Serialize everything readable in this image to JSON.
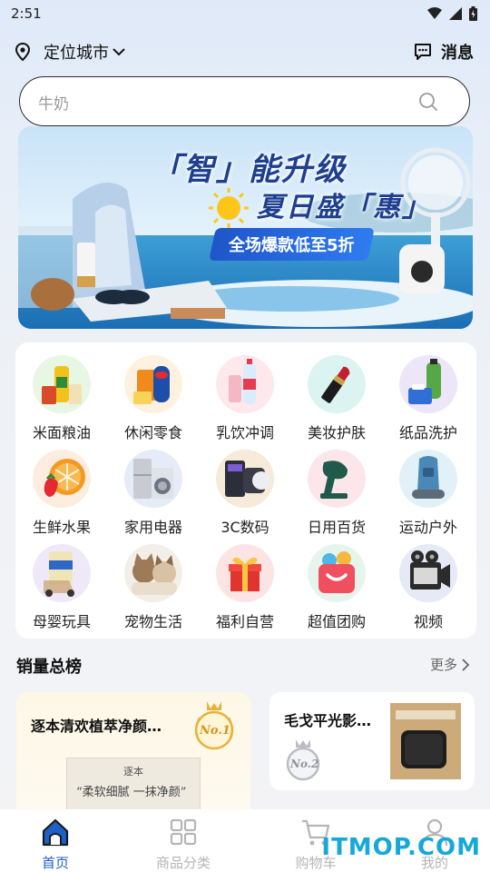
{
  "status": {
    "time": "2:51"
  },
  "header": {
    "location_label": "定位城市",
    "message_label": "消息"
  },
  "search": {
    "placeholder": "牛奶"
  },
  "banner": {
    "line1": "「智」能升级",
    "line2": "夏日盛「惠」",
    "promo": "全场爆款低至5折"
  },
  "categories": [
    {
      "label": "米面粮油",
      "icon": "grain-oil-icon"
    },
    {
      "label": "休闲零食",
      "icon": "snacks-icon"
    },
    {
      "label": "乳饮冲调",
      "icon": "drinks-icon"
    },
    {
      "label": "美妆护肤",
      "icon": "cosmetics-icon"
    },
    {
      "label": "纸品洗护",
      "icon": "paper-care-icon"
    },
    {
      "label": "生鲜水果",
      "icon": "fruit-icon"
    },
    {
      "label": "家用电器",
      "icon": "appliance-icon"
    },
    {
      "label": "3C数码",
      "icon": "digital-icon"
    },
    {
      "label": "日用百货",
      "icon": "daily-goods-icon"
    },
    {
      "label": "运动户外",
      "icon": "outdoor-icon"
    },
    {
      "label": "母婴玩具",
      "icon": "baby-icon"
    },
    {
      "label": "宠物生活",
      "icon": "pet-icon"
    },
    {
      "label": "福利自营",
      "icon": "gift-icon"
    },
    {
      "label": "超值团购",
      "icon": "group-buy-icon"
    },
    {
      "label": "视频",
      "icon": "video-icon"
    }
  ],
  "ranking": {
    "title": "销量总榜",
    "more_label": "更多",
    "items": [
      {
        "title": "逐本清欢植萃净颜…",
        "rank": "No.1",
        "product_brand": "逐本",
        "product_slogan": "“柔软细腻 一抹净颜”"
      },
      {
        "title": "毛戈平光影…",
        "rank": "No.2"
      }
    ]
  },
  "tabs": [
    {
      "label": "首页",
      "active": true,
      "icon": "home-icon"
    },
    {
      "label": "商品分类",
      "active": false,
      "icon": "category-icon"
    },
    {
      "label": "购物车",
      "active": false,
      "icon": "cart-icon"
    },
    {
      "label": "我的",
      "active": false,
      "icon": "profile-icon"
    }
  ],
  "watermark": "ITMOP.COM",
  "colors": {
    "accent": "#1e5fc8",
    "tab_inactive": "#b5b5b5",
    "watermark": "#16a8d8"
  }
}
